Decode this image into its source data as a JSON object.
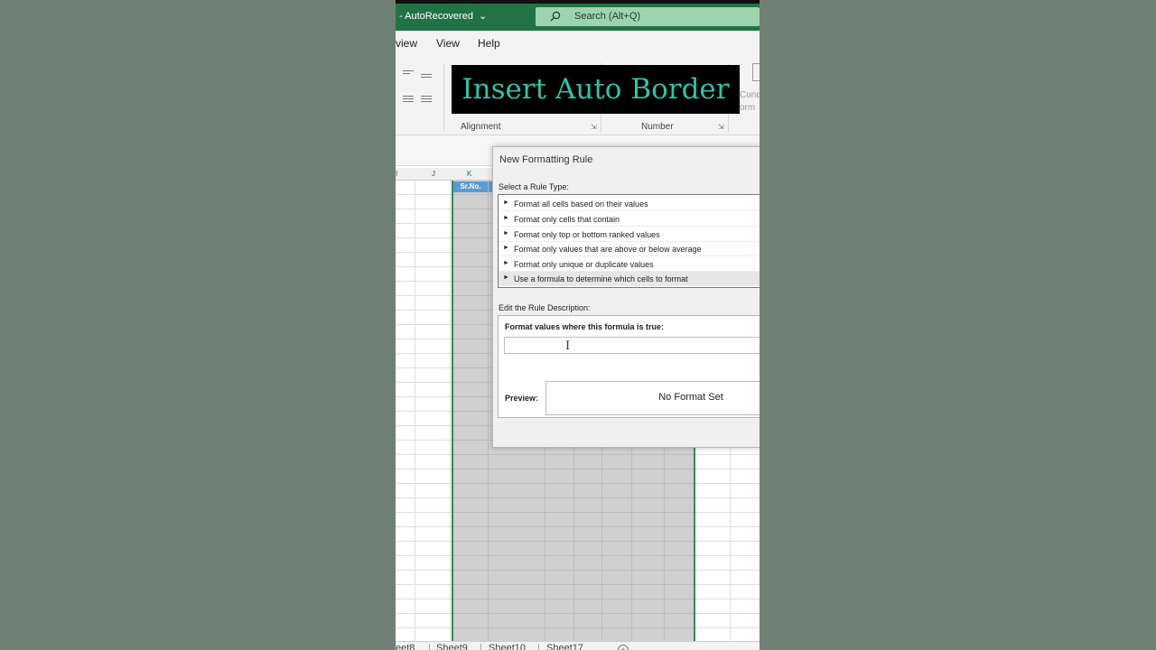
{
  "app": {
    "title_prefix": "-",
    "title": "AutoRecovered",
    "search_placeholder": "Search (Alt+Q)"
  },
  "menu": {
    "items": [
      "view",
      "View",
      "Help"
    ]
  },
  "ribbon": {
    "groups": [
      "Alignment",
      "Number"
    ],
    "partial_text_1": "Cond",
    "partial_text_2": "orm"
  },
  "overlay": {
    "caption": "Insert Auto Border"
  },
  "grid": {
    "columns": [
      "I",
      "J",
      "K"
    ],
    "selected_header": "Sr.No."
  },
  "dialog": {
    "title": "New Formatting Rule",
    "rule_type_label": "Select a Rule Type:",
    "rule_types": [
      "Format all cells based on their values",
      "Format only cells that contain",
      "Format only top or bottom ranked values",
      "Format only values that are above or below average",
      "Format only unique or duplicate values",
      "Use a formula to determine which cells to format"
    ],
    "selected_rule_index": 5,
    "description_label": "Edit the Rule Description:",
    "formula_heading": "Format values where this formula is true:",
    "formula_value": "",
    "preview_label": "Preview:",
    "preview_text": "No Format Set"
  },
  "sheets": {
    "tabs": [
      "eet8",
      "Sheet9",
      "Sheet10",
      "Sheet17"
    ],
    "add_label": "+"
  },
  "colors": {
    "titlebar": "#217346",
    "overlay_text": "#2fc3a9",
    "selection_border": "#2e8b57",
    "header_fill": "#5a9bd5"
  }
}
